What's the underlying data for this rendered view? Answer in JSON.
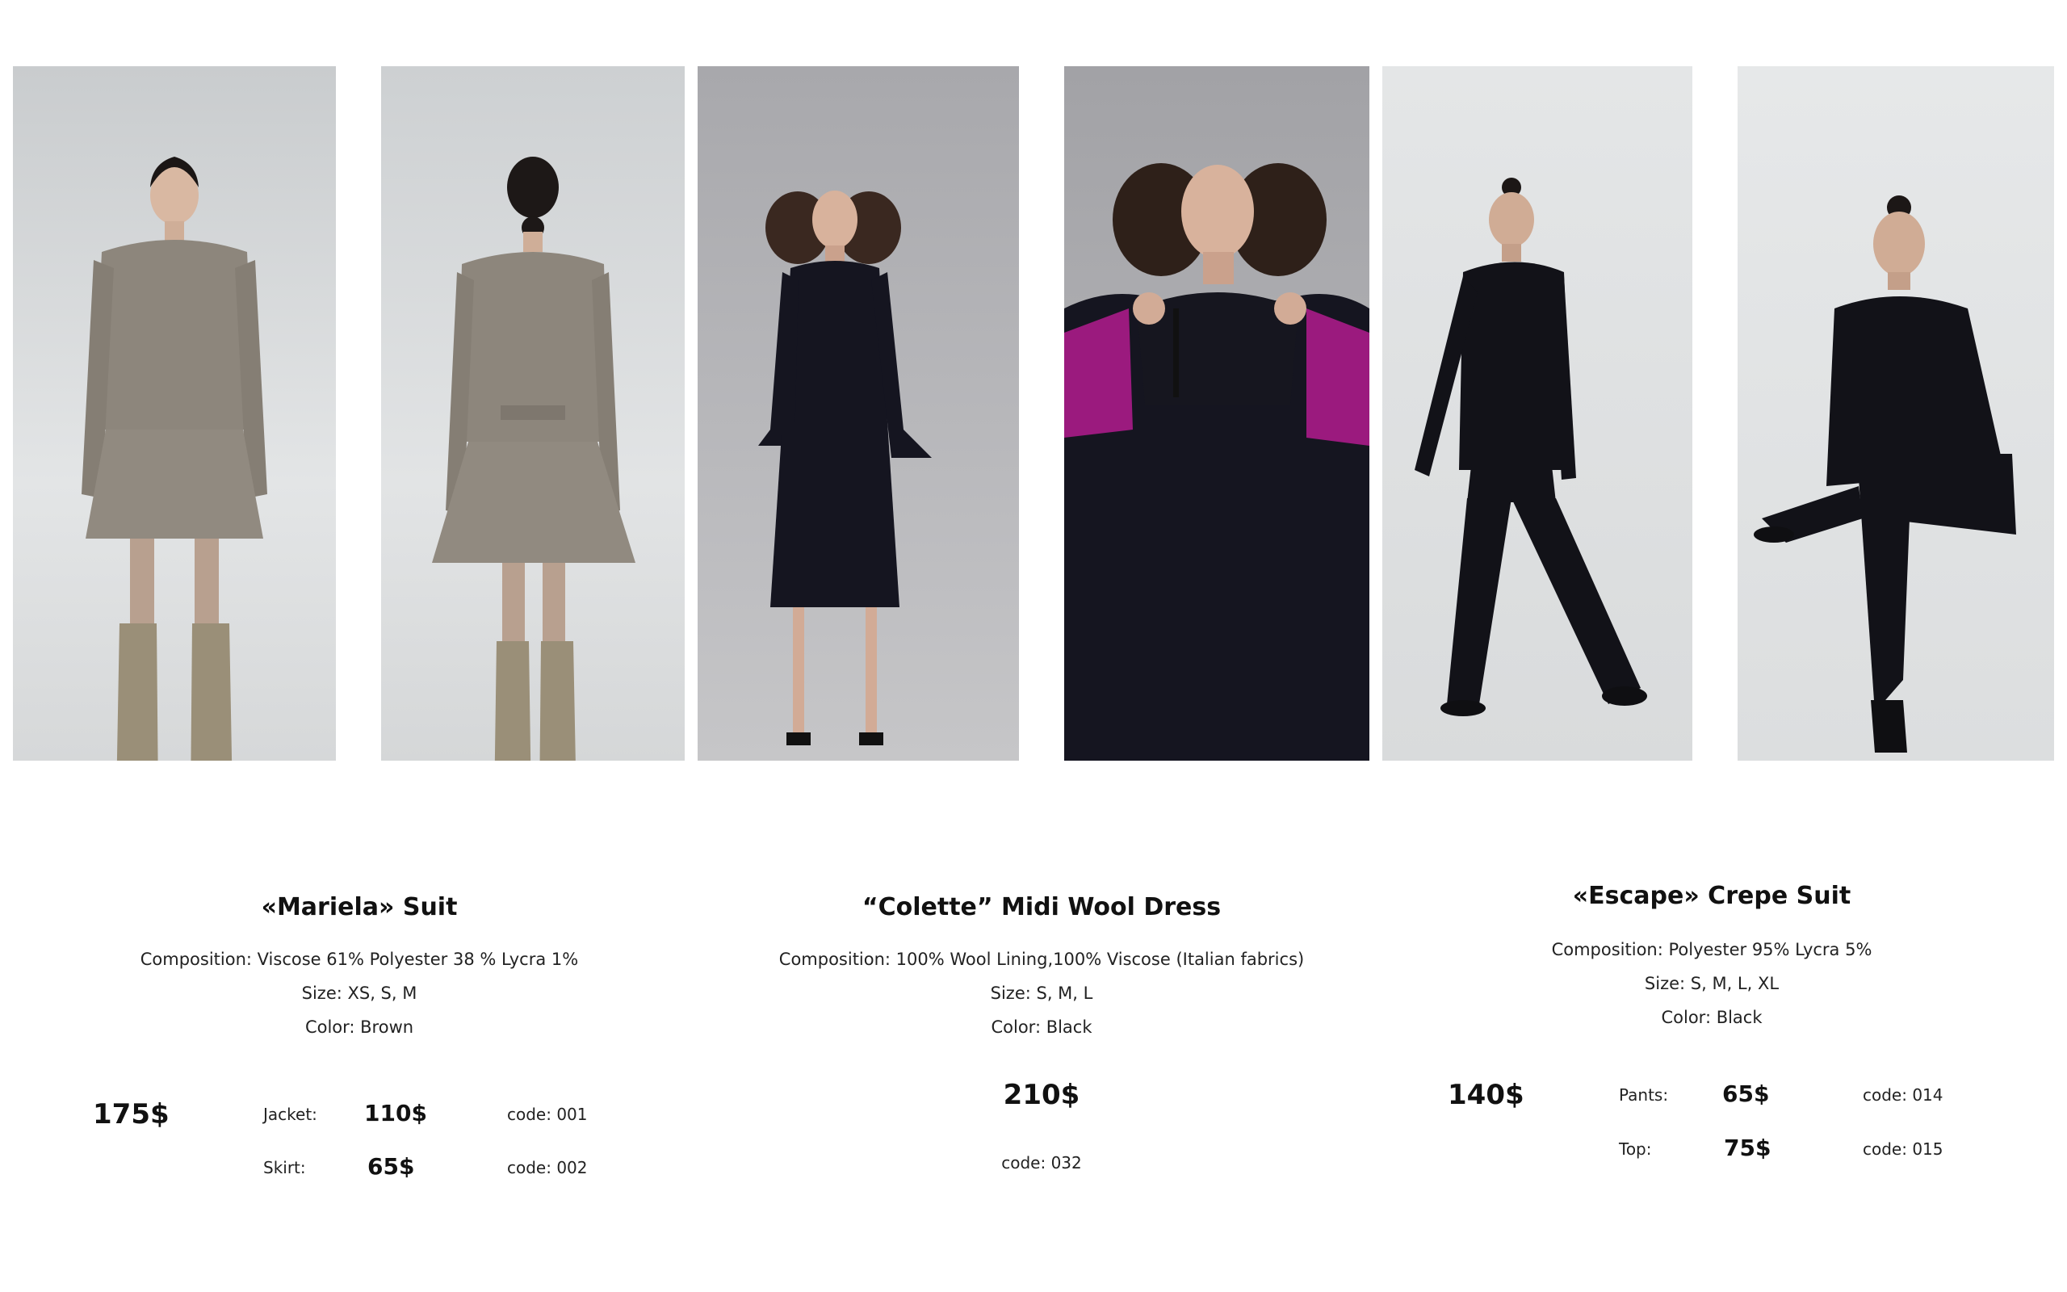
{
  "colors": {
    "background": "#ffffff",
    "text": "#111111",
    "studio_light": "#dde0e2",
    "studio_grey": "#a9a9ad",
    "suit_brown": "#8d867c",
    "garment_black": "#151520",
    "sleeve_magenta": "#9b1a7e",
    "boots_khaki": "#9a8f78"
  },
  "photos": [
    {
      "alt": "model-front-brown-suit-icon"
    },
    {
      "alt": "model-back-brown-suit-icon"
    },
    {
      "alt": "model-black-midi-dress-icon"
    },
    {
      "alt": "model-closeup-black-dress-icon"
    },
    {
      "alt": "model-walking-black-crepe-suit-icon"
    },
    {
      "alt": "model-seated-black-crepe-suit-icon"
    }
  ],
  "products": [
    {
      "title": "«Mariela» Suit",
      "composition": "Composition: Viscose 61% Polyester 38 % Lycra 1%",
      "size": "Size: XS, S, M",
      "color": "Color: Brown",
      "total_price": "175$",
      "items": [
        {
          "label": "Jacket:",
          "price": "110$",
          "code": "code: 001"
        },
        {
          "label": "Skirt:",
          "price": "65$",
          "code": "code: 002"
        }
      ]
    },
    {
      "title": "“Colette” Midi Wool Dress",
      "composition": "Composition:  100% Wool Lining,100% Viscose  (Italian fabrics)",
      "size": "Size: S, M, L",
      "color": "Color: Black",
      "price": "210$",
      "code": "code: 032"
    },
    {
      "title": "«Escape» Crepe Suit",
      "composition": "Composition: Polyester 95% Lycra 5%",
      "size": "Size: S, M, L, XL",
      "color": "Color: Black",
      "total_price": "140$",
      "items": [
        {
          "label": "Pants:",
          "price": "65$",
          "code": "code: 014"
        },
        {
          "label": "Top:",
          "price": "75$",
          "code": "code: 015"
        }
      ]
    }
  ]
}
